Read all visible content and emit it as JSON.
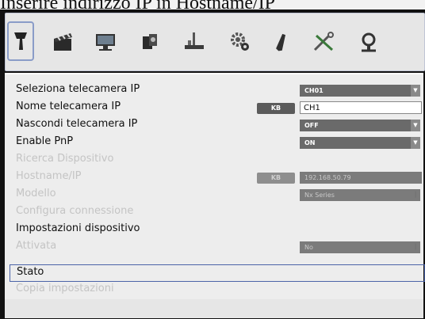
{
  "caption": "Inserire indirizzo IP in Hostname/IP",
  "toolbar": {
    "icons": [
      "camera-icon",
      "clapperboard-icon",
      "monitor-icon",
      "storage-drive-icon",
      "network-icon",
      "gear-icon",
      "usb-stick-icon",
      "tools-icon",
      "user-icon"
    ]
  },
  "settings": {
    "rows": [
      {
        "label": "Seleziona telecamera IP",
        "enabled": true,
        "control": "select",
        "value": "CH01"
      },
      {
        "label": "Nome telecamera IP",
        "enabled": true,
        "control": "text",
        "kb": "KB",
        "value": "CH1"
      },
      {
        "label": "Nascondi telecamera IP",
        "enabled": true,
        "control": "select",
        "value": "OFF"
      },
      {
        "label": "Enable PnP",
        "enabled": true,
        "control": "select",
        "value": "ON"
      },
      {
        "label": "Ricerca Dispositivo",
        "enabled": false
      },
      {
        "label": "Hostname/IP",
        "enabled": false,
        "control": "text",
        "kb": "KB",
        "value": "192.168.50.79"
      },
      {
        "label": "Modello",
        "enabled": false,
        "control": "select",
        "value": "Nx Series"
      },
      {
        "label": "Configura connessione",
        "enabled": false
      },
      {
        "label": "Impostazioni dispositivo",
        "enabled": true
      },
      {
        "label": "Attivata",
        "enabled": false,
        "control": "select",
        "value": "No"
      },
      {
        "label": "Stato",
        "enabled": true,
        "highlighted": true
      },
      {
        "label": "Copia impostazioni",
        "enabled": false
      }
    ]
  }
}
